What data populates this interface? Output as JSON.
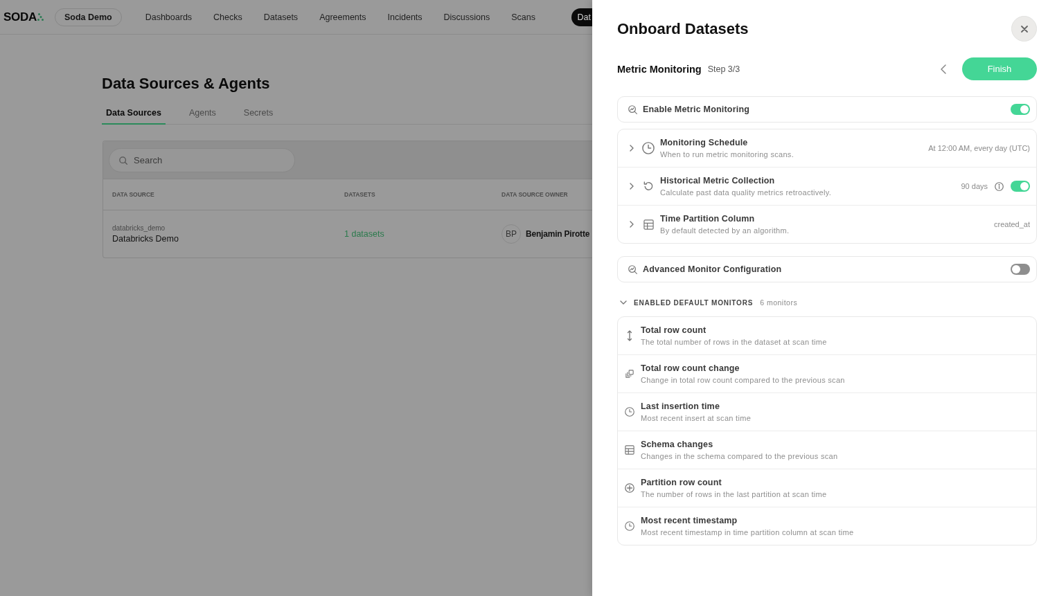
{
  "nav": {
    "logo": "SODA",
    "org": "Soda Demo",
    "items": [
      {
        "label": "Dashboards",
        "selected": false
      },
      {
        "label": "Checks",
        "selected": false
      },
      {
        "label": "Datasets",
        "selected": false
      },
      {
        "label": "Agreements",
        "selected": false
      },
      {
        "label": "Incidents",
        "selected": false
      },
      {
        "label": "Discussions",
        "selected": false
      },
      {
        "label": "Scans",
        "selected": false
      },
      {
        "label": "Dat",
        "selected": true
      }
    ]
  },
  "page": {
    "title": "Data Sources & Agents",
    "tabs": [
      {
        "label": "Data Sources",
        "selected": true
      },
      {
        "label": "Agents",
        "selected": false
      },
      {
        "label": "Secrets",
        "selected": false
      }
    ],
    "search": {
      "placeholder": "Search"
    },
    "table": {
      "columns": [
        "DATA SOURCE",
        "DATASETS",
        "DATA SOURCE OWNER"
      ],
      "rows": [
        {
          "key": "databricks_demo",
          "name": "Databricks Demo",
          "datasets": "1 datasets",
          "owner_initials": "BP",
          "owner": "Benjamin Pirotte"
        }
      ]
    }
  },
  "drawer": {
    "title": "Onboard Datasets",
    "step_title": "Metric Monitoring",
    "step": "Step 3/3",
    "finish": "Finish",
    "enable_monitoring": {
      "label": "Enable Metric Monitoring",
      "on": true
    },
    "settings": [
      {
        "kind": "value",
        "title": "Monitoring Schedule",
        "description": "When to run metric monitoring scans.",
        "value": "At 12:00 AM, every day (UTC)",
        "expanded": false
      },
      {
        "kind": "toggle",
        "title": "Historical Metric Collection",
        "description": "Calculate past data quality metrics retroactively.",
        "value": "90 days",
        "on": true,
        "expanded": false
      },
      {
        "kind": "value",
        "title": "Time Partition Column",
        "description": "By default detected by an algorithm.",
        "value": "created_at",
        "expanded": false
      }
    ],
    "advanced": {
      "label": "Advanced Monitor Configuration",
      "on": false
    },
    "monitors": {
      "label": "ENABLED DEFAULT MONITORS",
      "count": "6 monitors",
      "expanded": true,
      "items": [
        {
          "title": "Total row count",
          "description": "The total number of rows in the dataset at scan time"
        },
        {
          "title": "Total row count change",
          "description": "Change in total row count compared to the previous scan"
        },
        {
          "title": "Last insertion time",
          "description": "Most recent insert at scan time"
        },
        {
          "title": "Schema changes",
          "description": "Changes in the schema compared to the previous scan"
        },
        {
          "title": "Partition row count",
          "description": "The number of rows in the last partition at scan time"
        },
        {
          "title": "Most recent timestamp",
          "description": "Most recent timestamp in time partition column at scan time"
        }
      ]
    }
  }
}
